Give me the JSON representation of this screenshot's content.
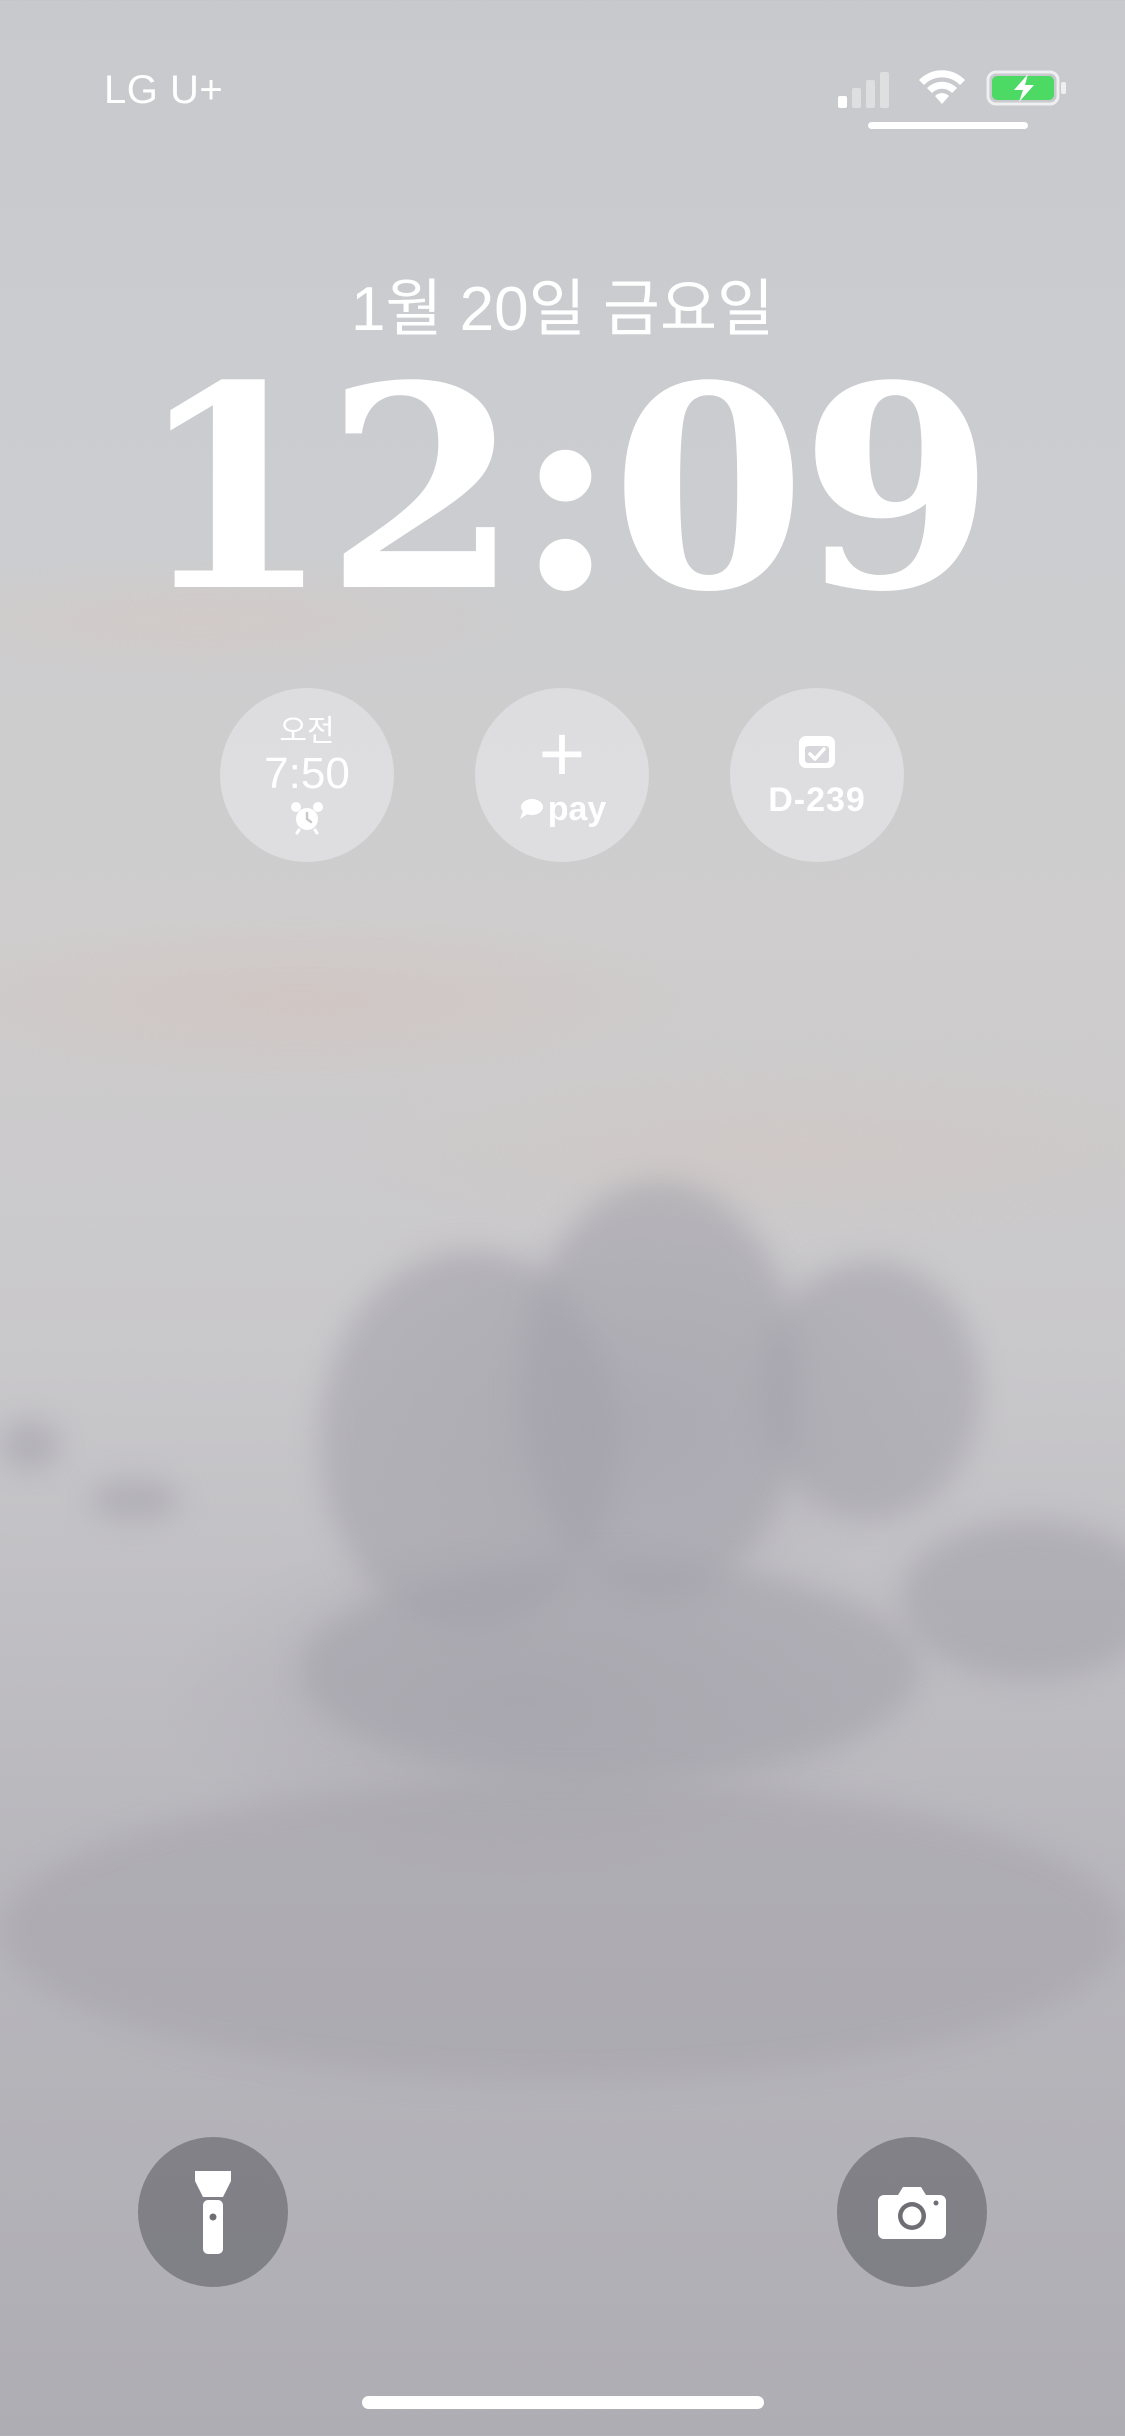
{
  "status_bar": {
    "carrier": "LG U+",
    "signal_bars_filled": 1,
    "signal_bars_total": 4,
    "wifi_icon": "wifi-icon",
    "battery_icon": "battery-charging-icon",
    "battery_color": "#4cd964"
  },
  "lock_screen": {
    "date": "1월 20일 금요일",
    "time": "12:09"
  },
  "widgets": {
    "alarm": {
      "ampm": "오전",
      "time": "7:50",
      "icon": "alarm-clock-icon"
    },
    "pay": {
      "symbol": "+",
      "label": "pay",
      "icon": "speech-bubble-icon"
    },
    "dday": {
      "label": "D-239",
      "icon": "calendar-check-icon"
    }
  },
  "bottom_buttons": {
    "flashlight": "flashlight-icon",
    "camera": "camera-icon"
  }
}
